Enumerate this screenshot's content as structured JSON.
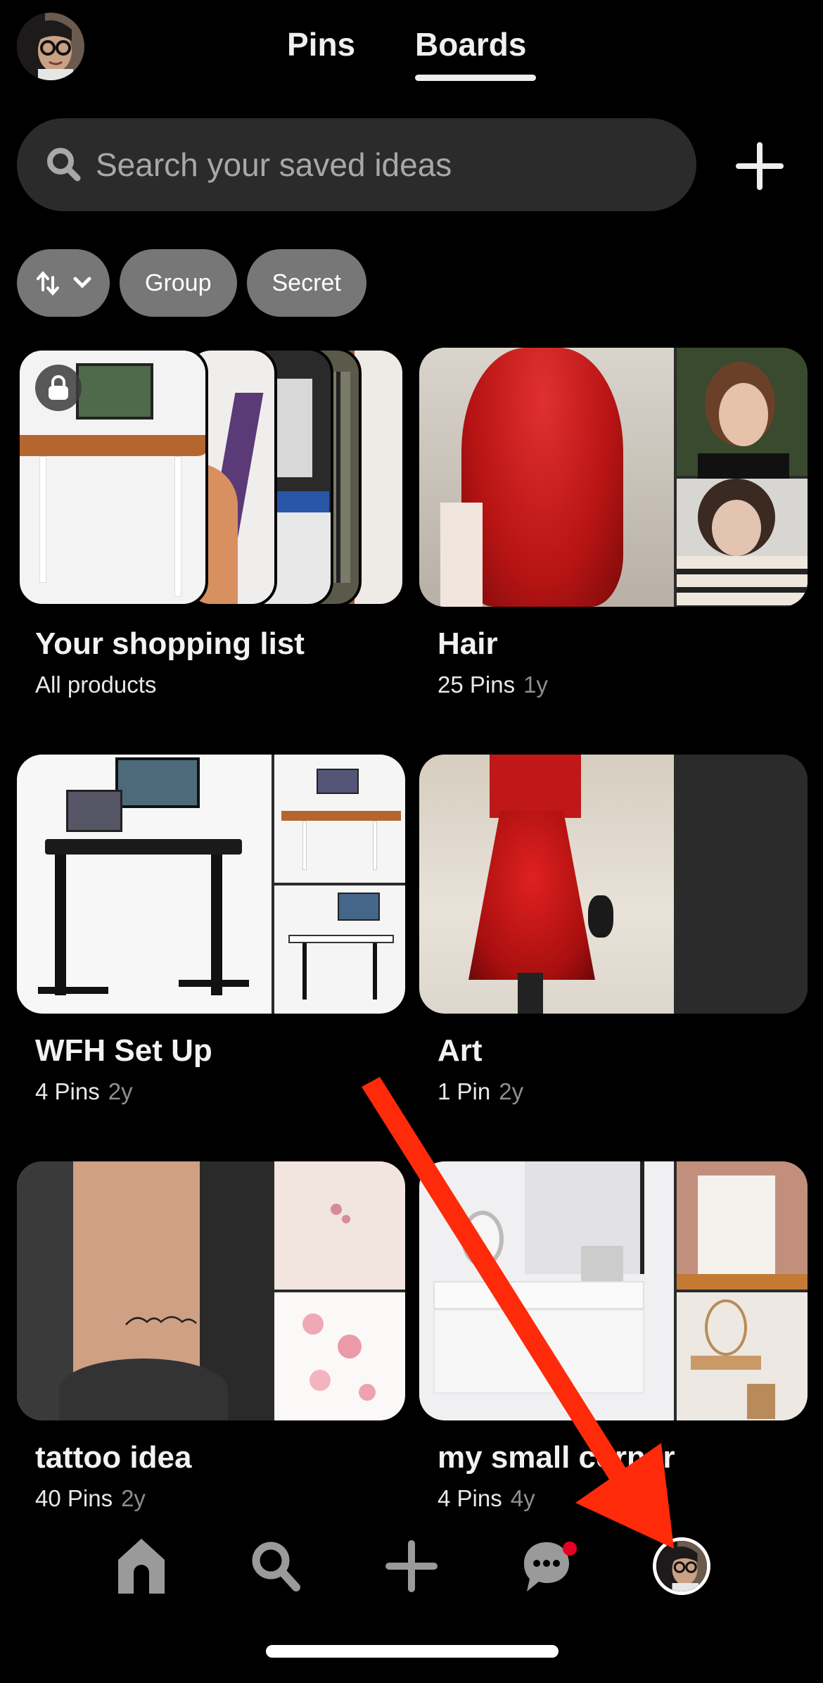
{
  "header": {
    "tabs": [
      {
        "label": "Pins",
        "active": false
      },
      {
        "label": "Boards",
        "active": true
      }
    ],
    "avatar_icon": "user-avatar"
  },
  "search": {
    "placeholder": "Search your saved ideas",
    "value": "",
    "icon": "search-icon"
  },
  "actions": {
    "add_icon": "plus-icon"
  },
  "filters": {
    "sort_icon": "sort-arrows-icon",
    "chips": [
      "Group",
      "Secret"
    ]
  },
  "boards": [
    {
      "title": "Your shopping list",
      "meta": "All products",
      "age": "",
      "secret": true
    },
    {
      "title": "Hair",
      "meta": "25 Pins",
      "age": "1y"
    },
    {
      "title": "WFH Set Up",
      "meta": "4 Pins",
      "age": "2y"
    },
    {
      "title": "Art",
      "meta": "1 Pin",
      "age": "2y"
    },
    {
      "title": "tattoo idea",
      "meta": "40 Pins",
      "age": "2y"
    },
    {
      "title": "my small corner",
      "meta": "4 Pins",
      "age": "4y"
    }
  ],
  "nav": {
    "items": [
      {
        "name": "home",
        "icon": "home-icon"
      },
      {
        "name": "search",
        "icon": "search-icon"
      },
      {
        "name": "create",
        "icon": "plus-icon"
      },
      {
        "name": "messages",
        "icon": "chat-icon",
        "has_notification": true
      },
      {
        "name": "profile",
        "icon": "user-avatar",
        "active": true
      }
    ]
  },
  "colors": {
    "background": "#000000",
    "surface": "#2b2b2b",
    "chip": "#777777",
    "notification": "#e60023",
    "annotation_arrow": "#ff2a0a"
  },
  "annotation": {
    "type": "arrow",
    "points_to": "profile"
  }
}
